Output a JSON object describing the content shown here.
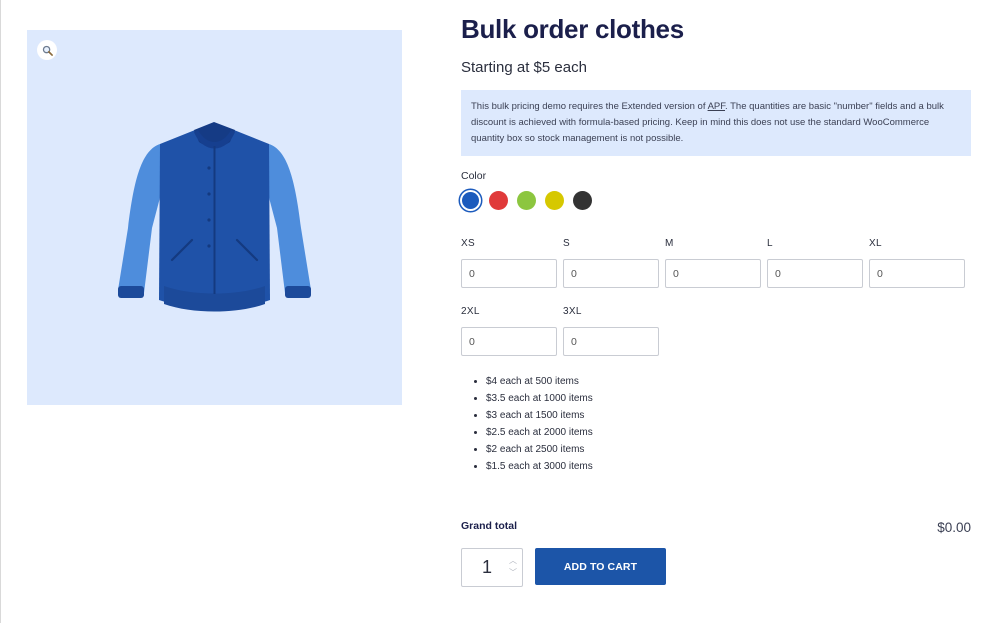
{
  "product": {
    "title": "Bulk order clothes",
    "price_text": "Starting at $5 each",
    "zoom_icon": "magnifier-icon"
  },
  "notice": {
    "before_link": "This bulk pricing demo requires the Extended version of ",
    "link_text": "APF",
    "after_link": ". The quantities are basic \"number\" fields and a bulk discount is achieved with formula-based pricing. Keep in mind this does not use the standard WooCommerce quantity box so stock management is not possible."
  },
  "color": {
    "label": "Color",
    "selected_index": 0,
    "swatches": [
      {
        "name": "blue",
        "hex": "#1c5bbd"
      },
      {
        "name": "red",
        "hex": "#e03a3a"
      },
      {
        "name": "green",
        "hex": "#8cc63f"
      },
      {
        "name": "yellow",
        "hex": "#d6c800"
      },
      {
        "name": "black",
        "hex": "#333333"
      }
    ]
  },
  "sizes": [
    {
      "label": "XS",
      "value": "0"
    },
    {
      "label": "S",
      "value": "0"
    },
    {
      "label": "M",
      "value": "0"
    },
    {
      "label": "L",
      "value": "0"
    },
    {
      "label": "XL",
      "value": "0"
    },
    {
      "label": "2XL",
      "value": "0"
    },
    {
      "label": "3XL",
      "value": "0"
    }
  ],
  "tiers": [
    "$4 each at 500 items",
    "$3.5 each at 1000 items",
    "$3 each at 1500 items",
    "$2.5 each at 2000 items",
    "$2 each at 2500 items",
    "$1.5 each at 3000 items"
  ],
  "total": {
    "label": "Grand total",
    "value": "$0.00"
  },
  "cart": {
    "quantity": "1",
    "button_label": "ADD TO CART"
  },
  "colors": {
    "accent": "#1c55a8",
    "title": "#1b1f4b",
    "panel_bg": "#dde9fd"
  }
}
